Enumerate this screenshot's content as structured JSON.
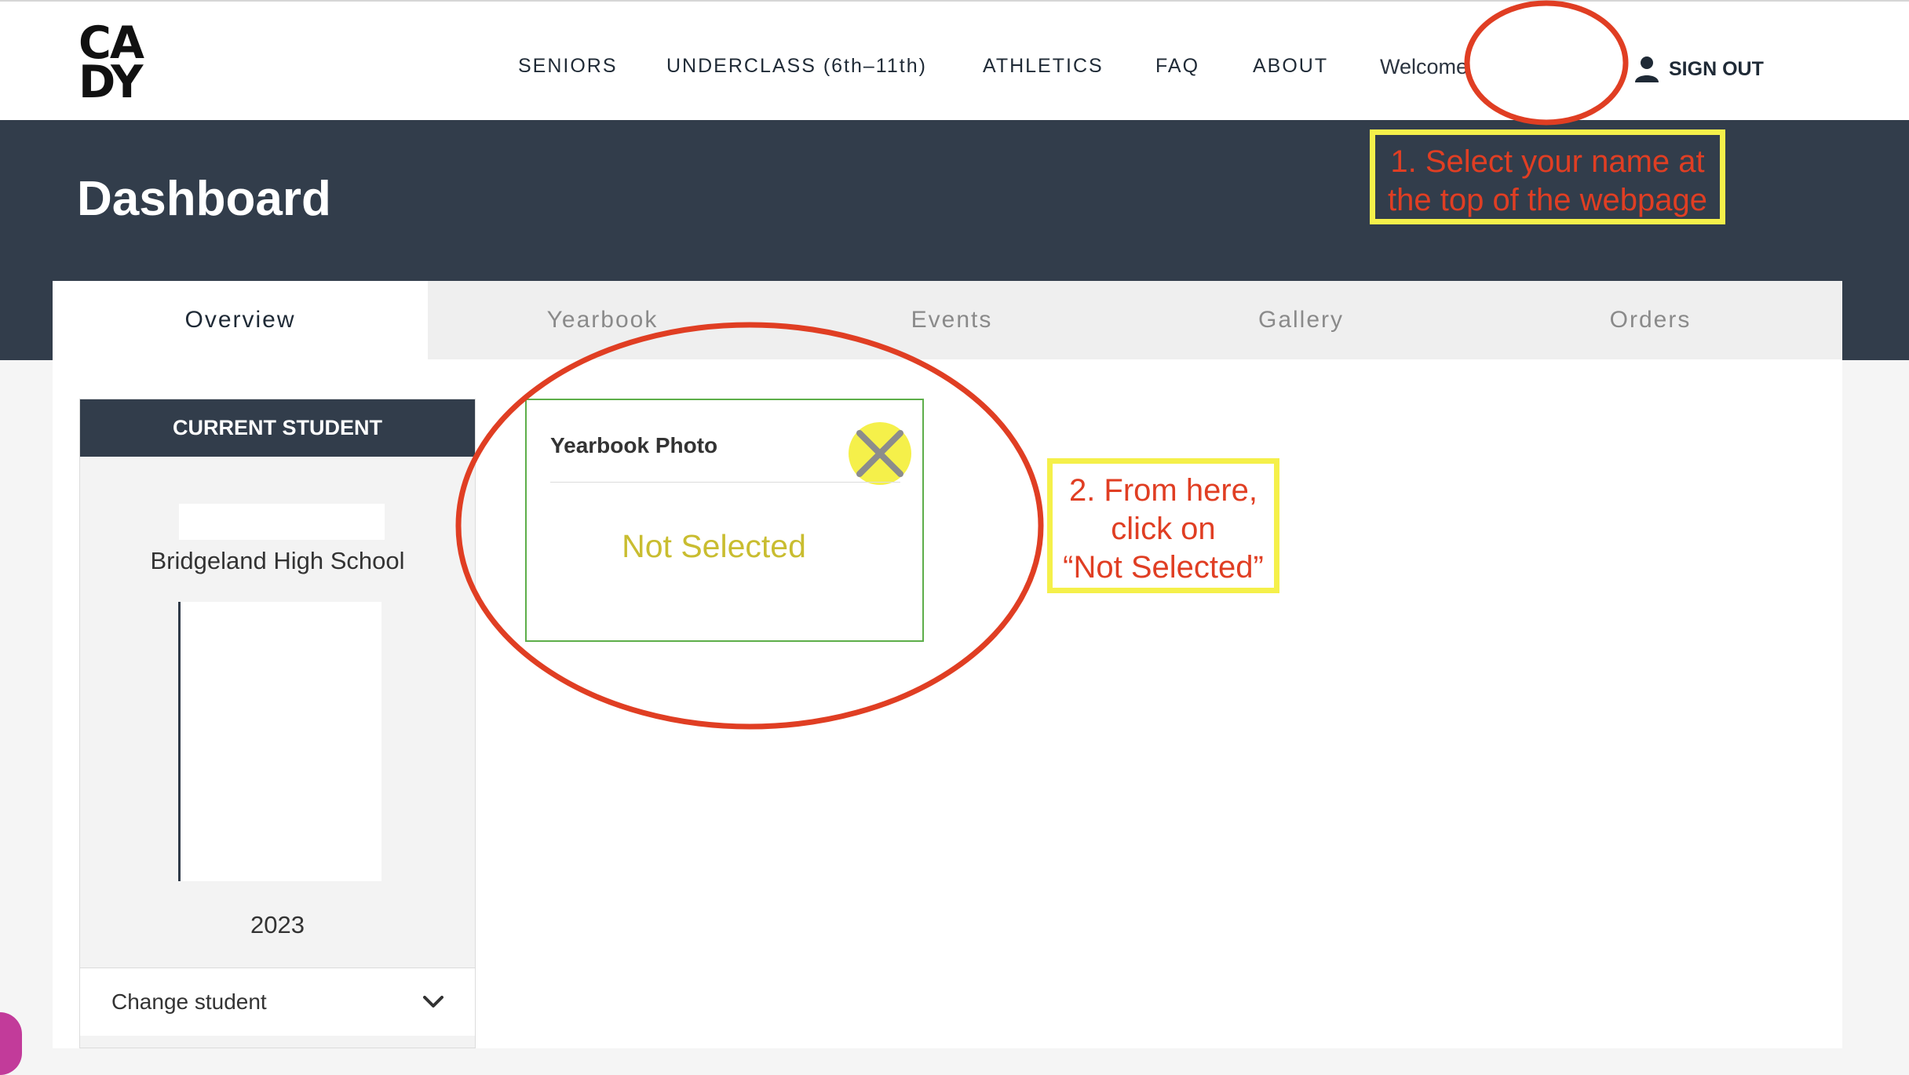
{
  "header": {
    "logo": {
      "line1": "CA",
      "line2": "DY"
    },
    "nav": [
      {
        "label": "SENIORS"
      },
      {
        "label": "UNDERCLASS (6th–11th)"
      },
      {
        "label": "ATHLETICS"
      },
      {
        "label": "FAQ"
      },
      {
        "label": "ABOUT"
      }
    ],
    "welcome": "Welcome",
    "sign_out": "SIGN OUT"
  },
  "page_title": "Dashboard",
  "tabs": [
    {
      "label": "Overview",
      "active": true
    },
    {
      "label": "Yearbook"
    },
    {
      "label": "Events"
    },
    {
      "label": "Gallery"
    },
    {
      "label": "Orders"
    }
  ],
  "student_panel": {
    "title": "CURRENT STUDENT",
    "school": "Bridgeland High School",
    "year": "2023",
    "change_student": "Change student"
  },
  "yearbook_card": {
    "title": "Yearbook Photo",
    "status": "Not Selected"
  },
  "annotations": {
    "step1": {
      "line1": "1. Select your name at",
      "line2": "the top of the webpage"
    },
    "step2": {
      "line1": "2. From here,",
      "line2": "click on",
      "line3": "“Not Selected”"
    }
  },
  "colors": {
    "banner": "#323d4b",
    "annotation_red": "#e03e23",
    "annotation_yellow": "#f5f04a",
    "status_text": "#c9bd30",
    "card_border": "#5dae4a"
  }
}
